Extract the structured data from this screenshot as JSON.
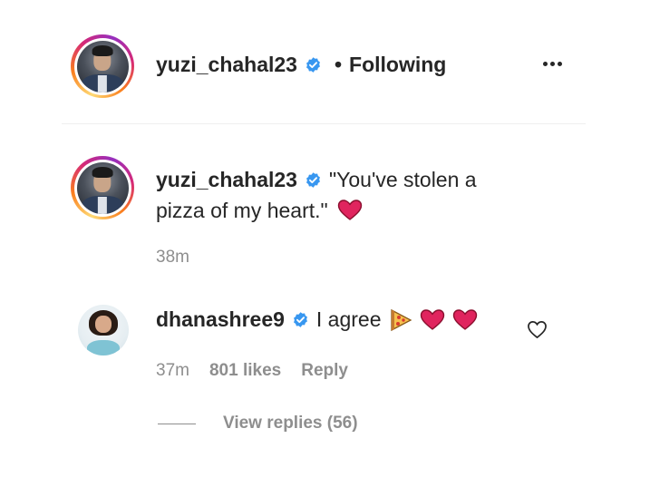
{
  "header": {
    "username": "yuzi_chahal23",
    "separator": "•",
    "follow_status": "Following"
  },
  "caption": {
    "username": "yuzi_chahal23",
    "line1": "\"You've stolen a",
    "line2": "pizza of my heart.\"",
    "emoji": "heart",
    "time": "38m"
  },
  "comment": {
    "username": "dhanashree9",
    "text": "I agree",
    "emojis": [
      "pizza",
      "heart",
      "heart"
    ],
    "time": "37m",
    "likes": "801 likes",
    "reply_label": "Reply",
    "view_replies": "View replies (56)"
  },
  "colors": {
    "verified": "#3897f0",
    "heart": "#e0245e",
    "text": "#262626",
    "meta": "#8e8e8e"
  },
  "icons": {
    "more": "more-options-icon",
    "verified": "verified-badge-icon",
    "like": "heart-outline-icon"
  }
}
